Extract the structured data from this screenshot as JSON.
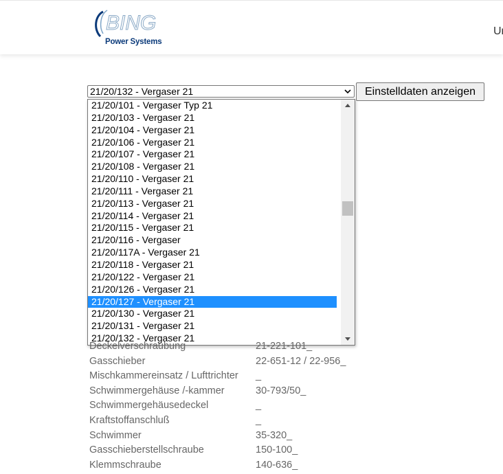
{
  "header": {
    "logo_text": "BING",
    "logo_subtitle": "Power Systems",
    "nav_partial": "Ur"
  },
  "form": {
    "selected_value": "21/20/132 - Vergaser 21",
    "button_label": "Einstelldaten anzeigen",
    "options": [
      "21/20/101 - Vergaser Typ 21",
      "21/20/103 - Vergaser 21",
      "21/20/104 - Vergaser 21",
      "21/20/106 - Vergaser 21",
      "21/20/107 - Vergaser 21",
      "21/20/108 - Vergaser 21",
      "21/20/110 - Vergaser 21",
      "21/20/111 - Vergaser 21",
      "21/20/113 - Vergaser 21",
      "21/20/114 - Vergaser 21",
      "21/20/115 - Vergaser 21",
      "21/20/116 - Vergaser",
      "21/20/117A - Vergaser 21",
      "21/20/118 - Vergaser 21",
      "21/20/122 - Vergaser 21",
      "21/20/126 - Vergaser 21",
      "21/20/127 - Vergaser 21",
      "21/20/130 - Vergaser 21",
      "21/20/131 - Vergaser 21",
      "21/20/132 - Vergaser 21"
    ],
    "highlighted_option": "21/20/127 - Vergaser 21",
    "highlight_color": "#1e90ff"
  },
  "table": [
    {
      "label": "Deckelverschraubung",
      "value": "21-221-101_"
    },
    {
      "label": "Gasschieber",
      "value": "22-651-12 / 22-956_"
    },
    {
      "label": "Mischkammereinsatz / Lufttrichter",
      "value": "_"
    },
    {
      "label": "Schwimmergehäuse /-kammer",
      "value": "30-793/50_"
    },
    {
      "label": "Schwimmergehäusedeckel",
      "value": "_"
    },
    {
      "label": "Kraftstoffanschluß",
      "value": "_"
    },
    {
      "label": "Schwimmer",
      "value": "35-320_"
    },
    {
      "label": "Gasschieberstellschraube",
      "value": "150-100_"
    },
    {
      "label": "Klemmschraube",
      "value": "140-636_"
    }
  ]
}
